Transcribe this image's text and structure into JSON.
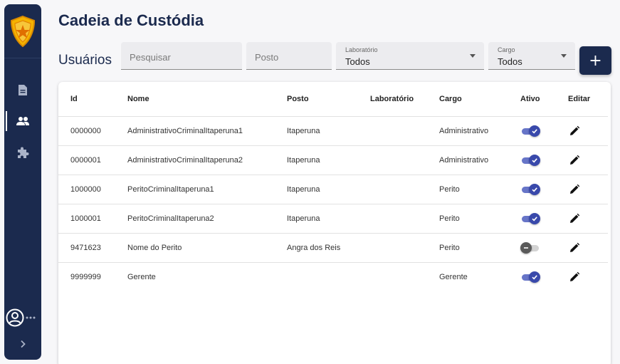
{
  "page": {
    "title": "Cadeia de Custódia",
    "section": "Usuários"
  },
  "sidebar": {
    "logo": "police-badge-logo",
    "items": [
      {
        "icon": "document-icon",
        "name": "sidebar-item-documents",
        "active": false
      },
      {
        "icon": "users-icon",
        "name": "sidebar-item-users",
        "active": true
      },
      {
        "icon": "puzzle-icon",
        "name": "sidebar-item-extensions",
        "active": false
      }
    ],
    "user_icon": "account-circle-icon",
    "more_icon": "more-dots-icon",
    "expand_icon": "chevron-right-icon"
  },
  "filters": {
    "search_placeholder": "Pesquisar",
    "posto_placeholder": "Posto",
    "laboratorio": {
      "label": "Laboratório",
      "value": "Todos"
    },
    "cargo": {
      "label": "Cargo",
      "value": "Todos"
    }
  },
  "add_button": {
    "label": "+"
  },
  "table": {
    "headers": {
      "id": "Id",
      "nome": "Nome",
      "posto": "Posto",
      "laboratorio": "Laboratório",
      "cargo": "Cargo",
      "ativo": "Ativo",
      "editar": "Editar"
    },
    "rows": [
      {
        "id": "0000000",
        "nome": "AdministrativoCriminalItaperuna1",
        "posto": "Itaperuna",
        "laboratorio": "",
        "cargo": "Administrativo",
        "ativo": true
      },
      {
        "id": "0000001",
        "nome": "AdministrativoCriminalItaperuna2",
        "posto": "Itaperuna",
        "laboratorio": "",
        "cargo": "Administrativo",
        "ativo": true
      },
      {
        "id": "1000000",
        "nome": "PeritoCriminalItaperuna1",
        "posto": "Itaperuna",
        "laboratorio": "",
        "cargo": "Perito",
        "ativo": true
      },
      {
        "id": "1000001",
        "nome": "PeritoCriminalItaperuna2",
        "posto": "Itaperuna",
        "laboratorio": "",
        "cargo": "Perito",
        "ativo": true
      },
      {
        "id": "9471623",
        "nome": "Nome do Perito",
        "posto": "Angra dos Reis",
        "laboratorio": "",
        "cargo": "Perito",
        "ativo": false
      },
      {
        "id": "9999999",
        "nome": "Gerente",
        "posto": "",
        "laboratorio": "",
        "cargo": "Gerente",
        "ativo": true
      }
    ]
  },
  "colors": {
    "primary": "#1b2a4e",
    "toggle_on": "#3949ab",
    "toggle_track_on": "#6775c8",
    "badge_gold": "#f5b301"
  }
}
